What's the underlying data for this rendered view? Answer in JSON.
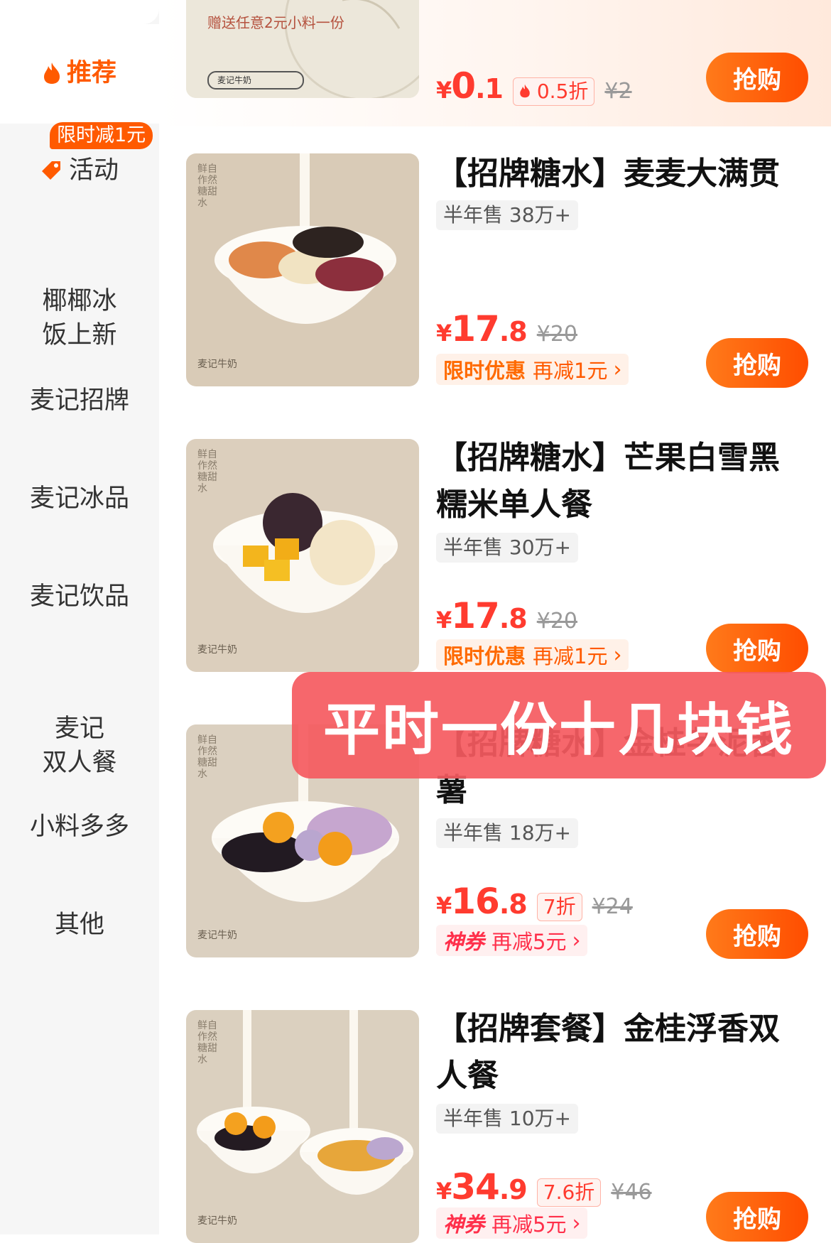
{
  "sidebar": {
    "items": [
      {
        "label": "推荐"
      },
      {
        "label": "活动",
        "badge": "限时减1元"
      },
      {
        "label": "椰椰冰\n饭上新"
      },
      {
        "label": "麦记招牌"
      },
      {
        "label": "麦记冰品"
      },
      {
        "label": "麦记饮品"
      },
      {
        "label": "麦记\n双人餐"
      },
      {
        "label": "小料多多"
      },
      {
        "label": "其他"
      }
    ]
  },
  "top_card": {
    "image_text": "赠送任意2元小料一份",
    "search_text": "麦记牛奶",
    "price_int": "0",
    "price_dec": ".1",
    "discount": "0.5折",
    "original": "¥2",
    "buy": "抢购"
  },
  "products": [
    {
      "title": "【招牌糖水】麦麦大满贯",
      "sales": "半年售 38万+",
      "price_int": "17",
      "price_dec": ".8",
      "original": "¥20",
      "promo_label": "限时优惠",
      "promo_sub": "再减1元",
      "buy": "抢购"
    },
    {
      "title": "【招牌糖水】芒果白雪黑糯米单人餐",
      "sales": "半年售 30万+",
      "price_int": "17",
      "price_dec": ".8",
      "original": "¥20",
      "promo_label": "限时优惠",
      "promo_sub": "再减1元",
      "buy": "抢购"
    },
    {
      "title": "【招牌糖水】金桂芋泥番薯",
      "sales": "半年售 18万+",
      "price_int": "16",
      "price_dec": ".8",
      "discount": "7折",
      "original": "¥24",
      "promo_label": "神券",
      "promo_sub": "再减5元",
      "buy": "抢购"
    },
    {
      "title": "【招牌套餐】金桂浮香双人餐",
      "sales": "半年售 10万+",
      "price_int": "34",
      "price_dec": ".9",
      "discount": "7.6折",
      "original": "¥46",
      "promo_label": "神券",
      "promo_sub": "再减5元",
      "buy": "抢购"
    }
  ],
  "thumb_text": {
    "side": "鲜自作然糖甜水",
    "brand": "麦记牛奶"
  },
  "currency": "¥",
  "overlay_caption": "平时一份十几块钱",
  "colors": {
    "accent": "#ff5a00",
    "price": "#ff3b2f",
    "overlay": "#f55a5f"
  }
}
